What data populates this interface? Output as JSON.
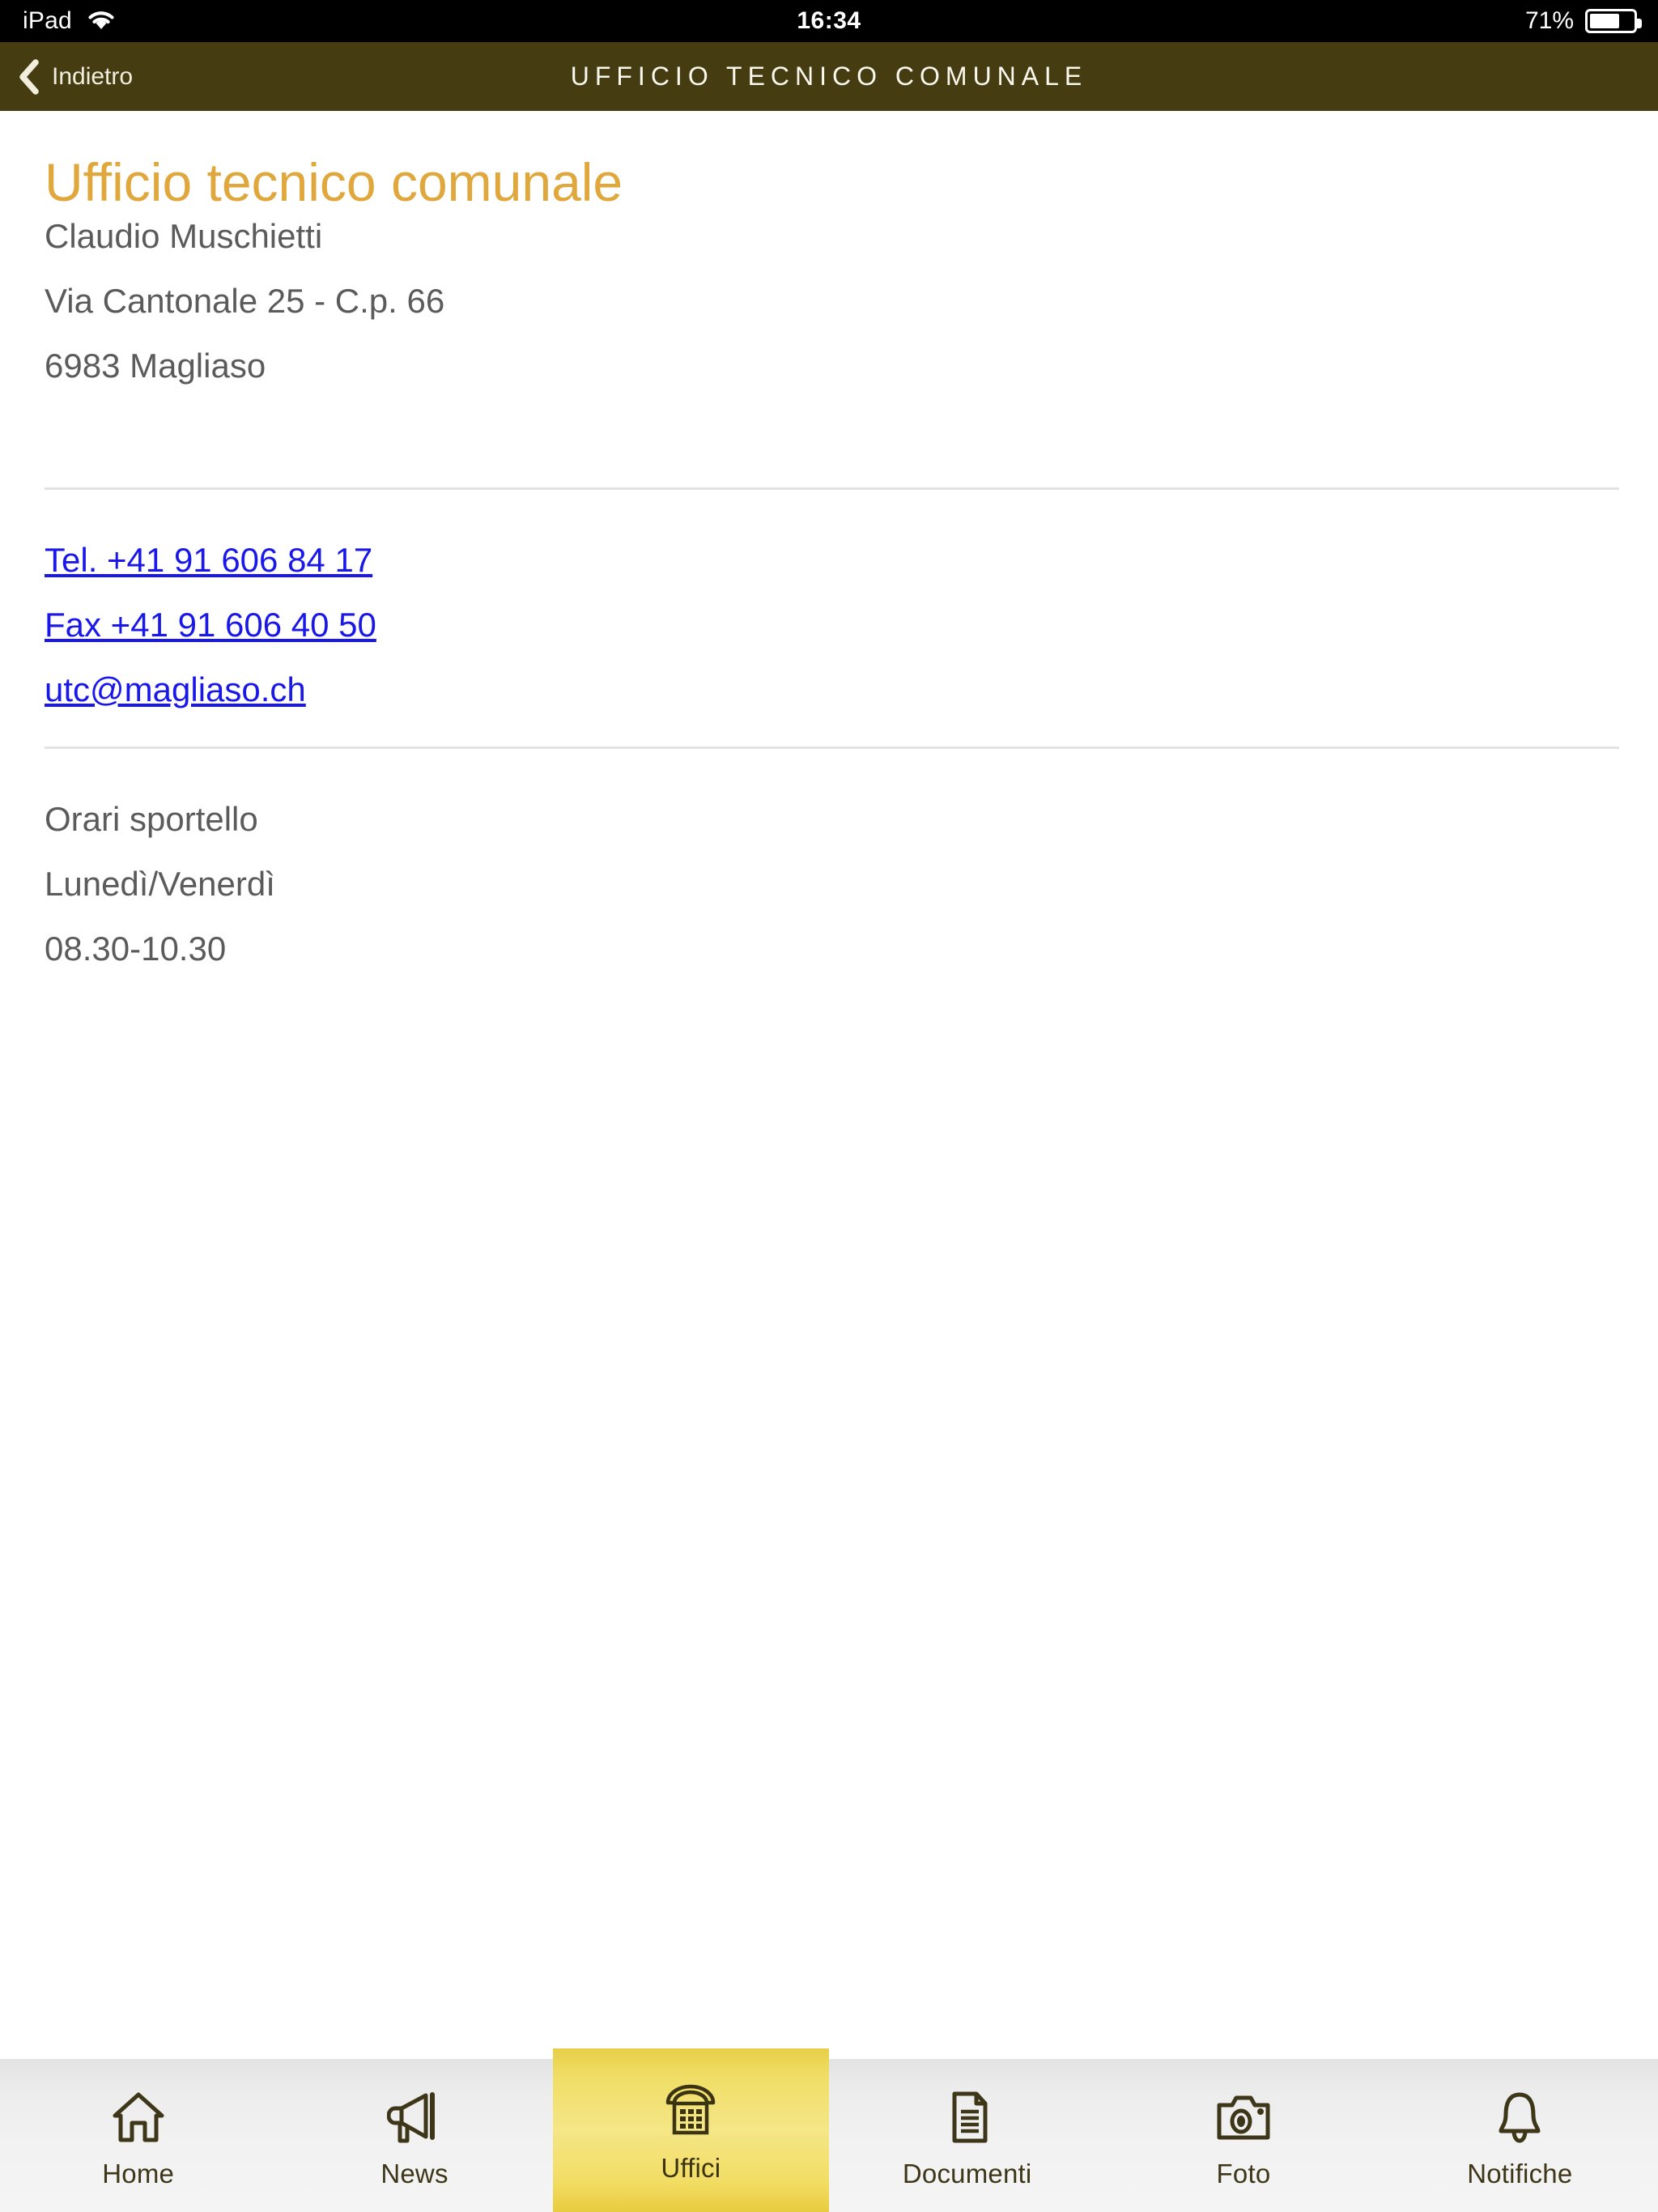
{
  "statusbar": {
    "device": "iPad",
    "wifi_icon": "wifi-icon",
    "time": "16:34",
    "battery_percent": "71%",
    "battery_icon": "battery-icon"
  },
  "navbar": {
    "back_icon": "chevron-left-icon",
    "back_label": "Indietro",
    "title": "UFFICIO TECNICO COMUNALE",
    "background_color": "#463c12",
    "text_color": "#faf7ec"
  },
  "page": {
    "heading": "Ufficio tecnico comunale",
    "heading_color": "#e0a73c",
    "address": {
      "contact_name": "Claudio Muschietti",
      "street": "Via Cantonale 25 - C.p. 66",
      "city": "6983 Magliaso"
    },
    "contacts": {
      "phone": "Tel. +41 91 606 84 17",
      "fax": "Fax +41 91 606 40 50",
      "email": "utc@magliaso.ch",
      "link_color": "#1a18e8"
    },
    "hours": {
      "title": "Orari sportello",
      "days": "Lunedì/Venerdì",
      "times": "08.30-10.30"
    }
  },
  "tabbar": {
    "active_color": "#f2dd63",
    "icon_color": "#3d3618",
    "items": [
      {
        "label": "Home",
        "icon": "home-icon",
        "active": false
      },
      {
        "label": "News",
        "icon": "megaphone-icon",
        "active": false
      },
      {
        "label": "Uffici",
        "icon": "telephone-icon",
        "active": true
      },
      {
        "label": "Documenti",
        "icon": "document-icon",
        "active": false
      },
      {
        "label": "Foto",
        "icon": "camera-icon",
        "active": false
      },
      {
        "label": "Notifiche",
        "icon": "bell-icon",
        "active": false
      }
    ]
  }
}
